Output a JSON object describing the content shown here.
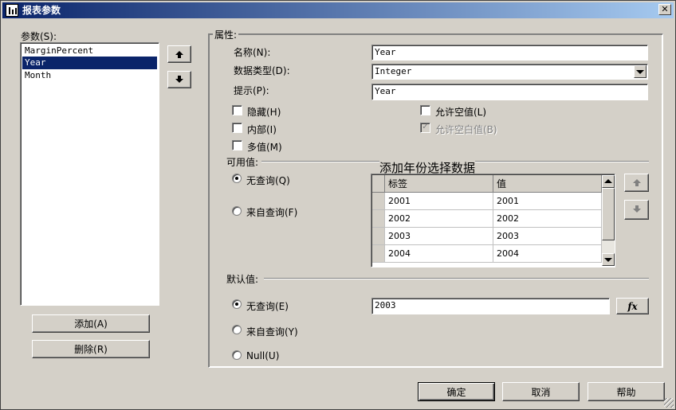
{
  "window": {
    "title": "报表参数",
    "close_glyph": "✕"
  },
  "params": {
    "label": "参数(S):",
    "items": [
      "MarginPercent",
      "Year",
      "Month"
    ],
    "selected_index": 1,
    "add_label": "添加(A)",
    "delete_label": "删除(R)"
  },
  "properties": {
    "group_label": "属性:",
    "name_label": "名称(N):",
    "name_value": "Year",
    "type_label": "数据类型(D):",
    "type_value": "Integer",
    "prompt_label": "提示(P):",
    "prompt_value": "Year",
    "hidden_label": "隐藏(H)",
    "internal_label": "内部(I)",
    "multi_label": "多值(M)",
    "allow_null_label": "允许空值(L)",
    "allow_blank_label": "允许空白值(B)",
    "allow_blank_check": "✓"
  },
  "available": {
    "label": "可用值:",
    "annotation": "添加年份选择数据",
    "no_query_label": "无查询(Q)",
    "from_query_label": "来自查询(F)",
    "columns": [
      "标签",
      "值"
    ],
    "rows": [
      [
        "2001",
        "2001"
      ],
      [
        "2002",
        "2002"
      ],
      [
        "2003",
        "2003"
      ],
      [
        "2004",
        "2004"
      ]
    ]
  },
  "default": {
    "label": "默认值:",
    "no_query_label": "无查询(E)",
    "from_query_label": "来自查询(Y)",
    "null_label": "Null(U)",
    "value": "2003",
    "fx_label": "fx"
  },
  "footer": {
    "ok_label": "确定",
    "cancel_label": "取消",
    "help_label": "帮助"
  },
  "colors": {
    "face": "#d4d0c8",
    "title_start": "#0a246a",
    "title_end": "#a6caf0",
    "selection": "#0a246a"
  }
}
